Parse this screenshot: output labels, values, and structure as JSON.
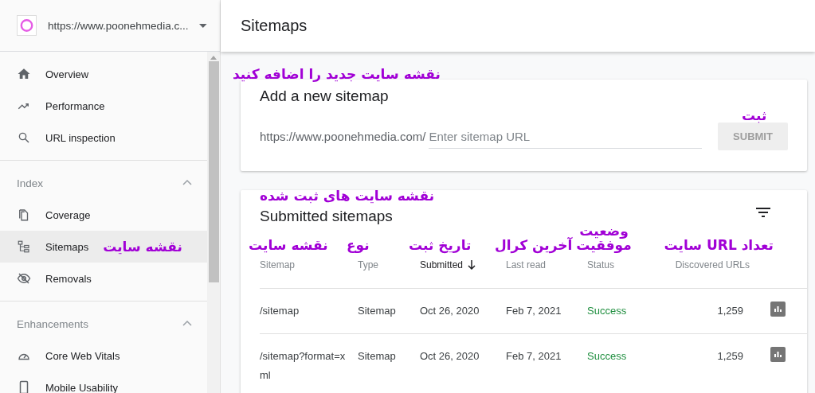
{
  "property": {
    "url": "https://www.poonehmedia.c..."
  },
  "sections": [
    {
      "items": [
        {
          "label": "Overview",
          "selected": false
        },
        {
          "label": "Performance",
          "selected": false
        },
        {
          "label": "URL inspection",
          "selected": false
        }
      ]
    },
    {
      "header": "Index",
      "expanded": true,
      "items": [
        {
          "label": "Coverage",
          "selected": false
        },
        {
          "label": "Sitemaps",
          "selected": true,
          "annotation": "نقشه سایت"
        },
        {
          "label": "Removals",
          "selected": false
        }
      ]
    },
    {
      "header": "Enhancements",
      "expanded": true,
      "items": [
        {
          "label": "Core Web Vitals",
          "selected": false
        },
        {
          "label": "Mobile Usability",
          "selected": false
        }
      ]
    }
  ],
  "page_title": "Sitemaps",
  "add_card": {
    "annotation": "نقشه سایت جدید را اضافه کنید",
    "title": "Add a new sitemap",
    "prefix": "https://www.poonehmedia.com/",
    "placeholder": "Enter sitemap URL",
    "button": "SUBMIT",
    "button_annotation": "ثبت",
    "button_disabled": true
  },
  "submitted": {
    "annotation": "نقشه سایت های ثبت شده",
    "title": "Submitted sitemaps",
    "columns": [
      {
        "label": "Sitemap",
        "annotation": "نقشه سایت",
        "kind": "text",
        "sorted": false
      },
      {
        "label": "Type",
        "annotation": "نوع",
        "kind": "text",
        "sorted": false
      },
      {
        "label": "Submitted",
        "annotation": "تاریخ ثبت",
        "kind": "text",
        "sorted": true
      },
      {
        "label": "Last read",
        "annotation": "آخرین کرال",
        "kind": "text",
        "sorted": false
      },
      {
        "label": "Status",
        "annotation": "وضعیت موفقیت",
        "kind": "status",
        "sorted": false
      },
      {
        "label": "Discovered URLs",
        "annotation": "تعداد URL سایت",
        "kind": "number",
        "sorted": false
      }
    ],
    "rows": [
      [
        "/sitemap",
        "Sitemap",
        "Oct 26, 2020",
        "Feb 7, 2021",
        "Success",
        "1,259"
      ],
      [
        "/sitemap?format=xml",
        "Sitemap",
        "Oct 26, 2020",
        "Feb 7, 2021",
        "Success",
        "1,259"
      ]
    ]
  }
}
